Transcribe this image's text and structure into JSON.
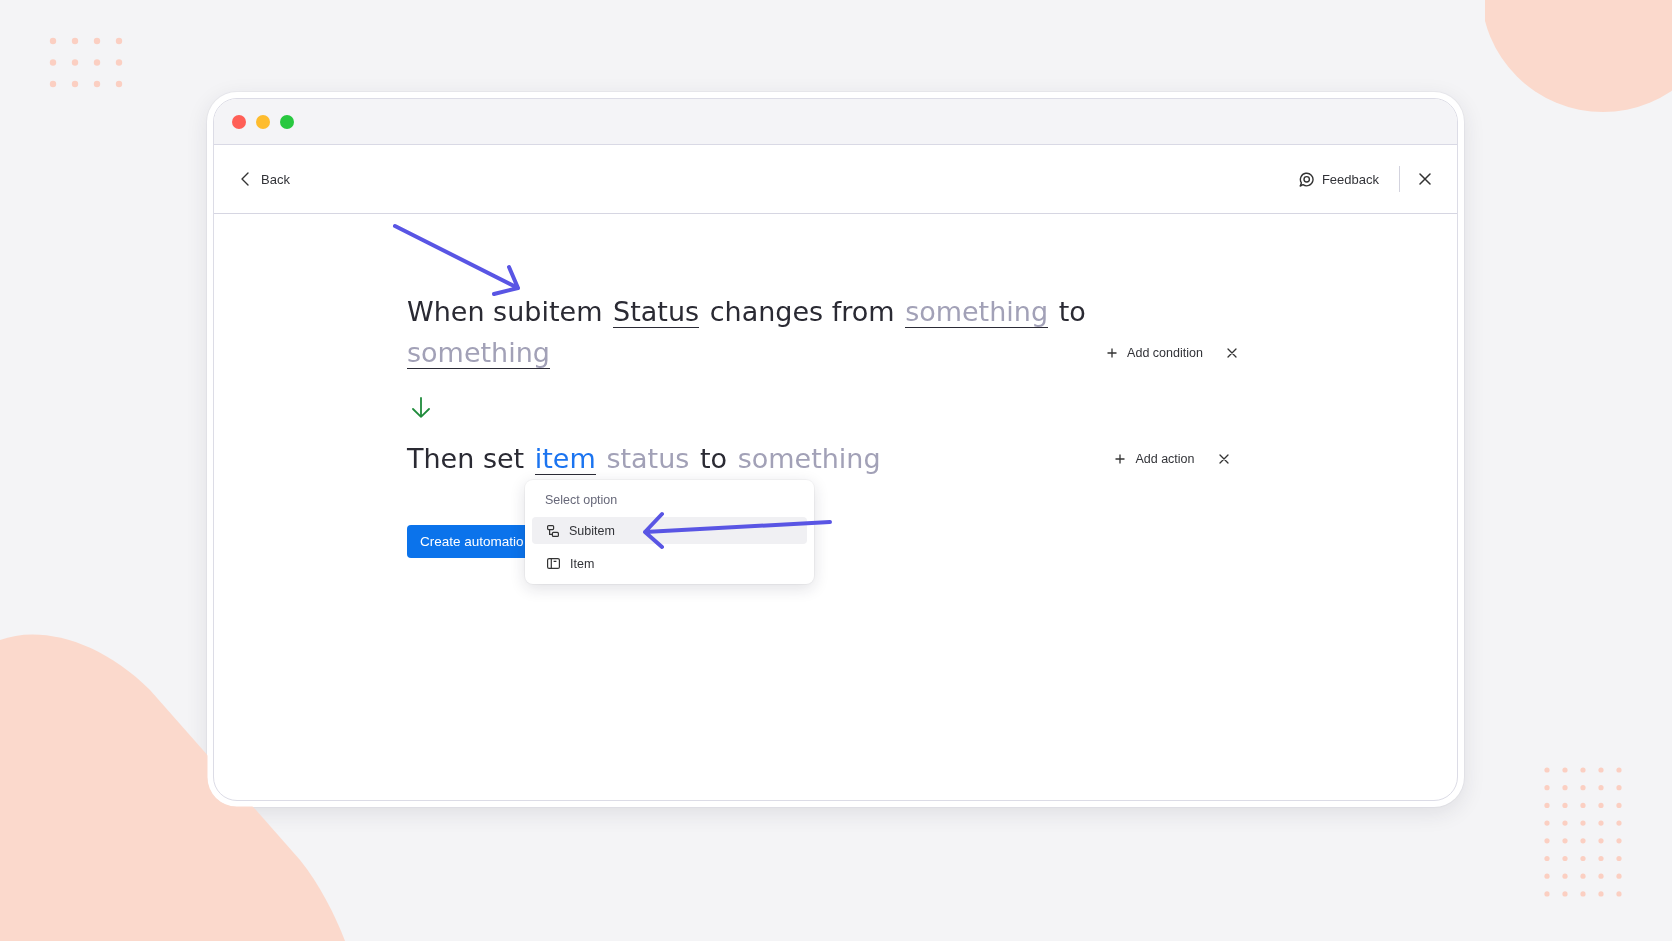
{
  "window": {
    "controls": [
      {
        "color": "#ff5f57"
      },
      {
        "color": "#febc2e"
      },
      {
        "color": "#28c840"
      }
    ]
  },
  "header": {
    "back": "Back",
    "feedback": "Feedback"
  },
  "trigger": {
    "segments": [
      {
        "kind": "text",
        "text": "When subitem"
      },
      {
        "kind": "field",
        "text": "Status",
        "placeholder": false,
        "selected": false,
        "disabled": false
      },
      {
        "kind": "text",
        "text": "changes from"
      },
      {
        "kind": "field",
        "text": "something",
        "placeholder": true,
        "selected": false,
        "disabled": false
      },
      {
        "kind": "text",
        "text": "to"
      },
      {
        "kind": "field",
        "text": "something",
        "placeholder": true,
        "selected": false,
        "disabled": false
      }
    ],
    "add_button": "Add condition"
  },
  "action": {
    "segments": [
      {
        "kind": "text",
        "text": "Then set"
      },
      {
        "kind": "field",
        "text": "item",
        "placeholder": false,
        "selected": true,
        "disabled": false
      },
      {
        "kind": "field",
        "text": "status",
        "placeholder": true,
        "selected": false,
        "disabled": true
      },
      {
        "kind": "text",
        "text": "to"
      },
      {
        "kind": "field",
        "text": "something",
        "placeholder": true,
        "selected": false,
        "disabled": true
      }
    ],
    "add_button": "Add action"
  },
  "create_button": "Create automatio",
  "dropdown": {
    "title": "Select option",
    "options": [
      {
        "kind": "subitem",
        "label": "Subitem",
        "selected": true
      },
      {
        "kind": "item",
        "label": "Item",
        "selected": false
      }
    ]
  }
}
